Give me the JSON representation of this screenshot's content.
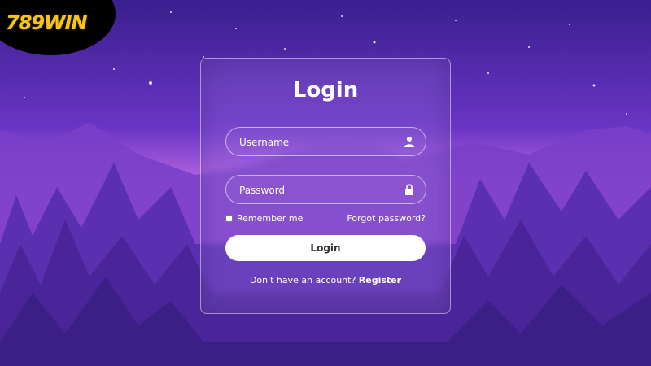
{
  "brand": {
    "logo_text": "789WIN"
  },
  "login": {
    "title": "Login",
    "username_placeholder": "Username",
    "password_placeholder": "Password",
    "remember_label": "Remember me",
    "forgot_label": "Forgot password?",
    "submit_label": "Login",
    "no_account_text": "Don't have an account?",
    "register_label": "Register"
  },
  "icons": {
    "username": "user-icon",
    "password": "lock-icon"
  },
  "colors": {
    "accent": "#f5c518",
    "background": "#5a2fb0",
    "button": "#ffffff"
  }
}
